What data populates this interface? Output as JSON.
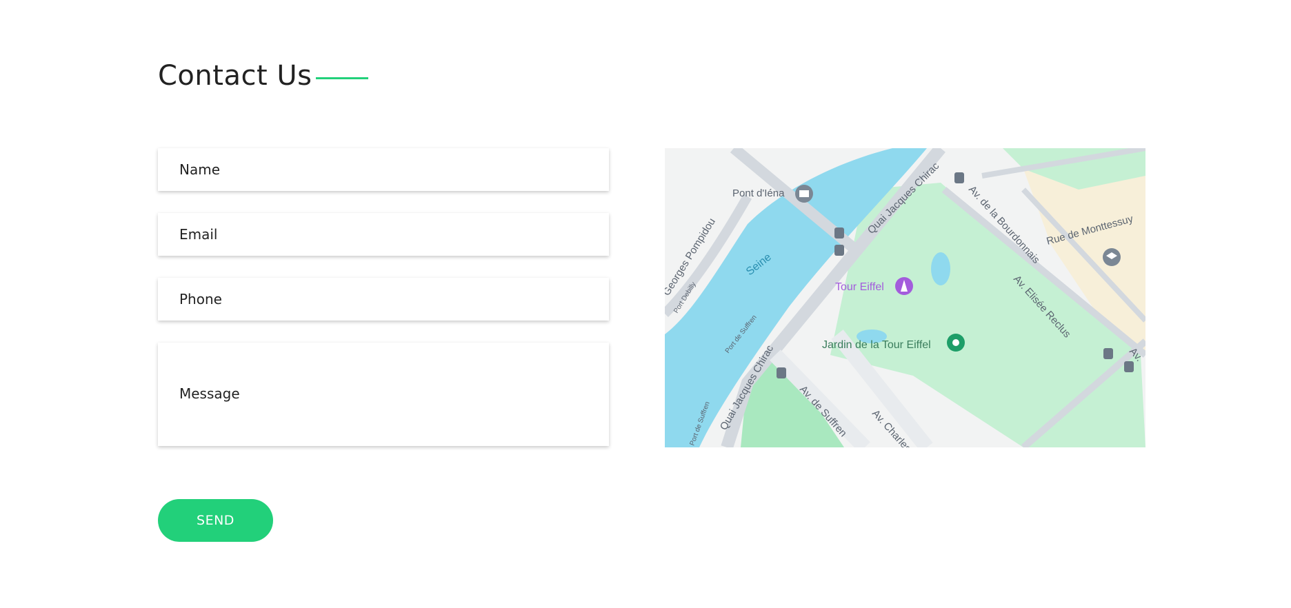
{
  "colors": {
    "accent": "#22d07a",
    "water": "#8fd9ee",
    "park": "#c5f0d3",
    "park_dark": "#a9e8bf",
    "road": "#d3d8de",
    "poi_purple": "#a35cdc",
    "poi_green": "#1e9e68"
  },
  "header": {
    "title": "Contact Us"
  },
  "form": {
    "name_placeholder": "Name",
    "email_placeholder": "Email",
    "phone_placeholder": "Phone",
    "message_placeholder": "Message",
    "send_label": "SEND"
  },
  "map": {
    "labels": {
      "pont_diena": "Pont d'Iéna",
      "seine": "Seine",
      "quai_chirac_top": "Quai Jacques Chirac",
      "quai_chirac_bottom": "Quai Jacques Chirac",
      "georges_pompidou": "Georges Pompidou",
      "port_debilly": "Port Debilly",
      "port_de_suffren": "Port de Suffren",
      "port_de_suffren_2": "Port de Suffren",
      "av_bourdonnais": "Av. de la Bourdonnais",
      "rue_monttessuy": "Rue de Monttessuy",
      "av_elisee_reclus": "Av. Elisée Reclus",
      "tour_eiffel": "Tour Eiffel",
      "jardin": "Jardin de la Tour Eiffel",
      "av_de_suffren": "Av. de Suffren",
      "av_charles": "Av. Charles",
      "av_short": "Av."
    },
    "icons": [
      "bridge-icon",
      "bus-stop-icon",
      "monument-icon",
      "garden-icon",
      "school-icon"
    ]
  }
}
